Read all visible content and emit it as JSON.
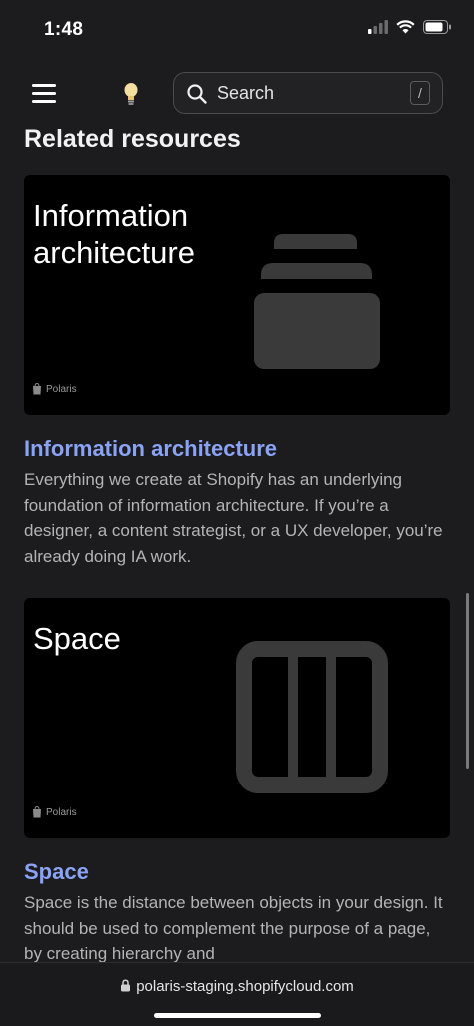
{
  "status_bar": {
    "time": "1:48"
  },
  "header": {
    "search": {
      "placeholder": "Search",
      "shortcut": "/"
    }
  },
  "section": {
    "title": "Related resources"
  },
  "cards": [
    {
      "thumb_title": "Information architecture",
      "brand": "Polaris",
      "title": "Information architecture",
      "description": "Everything we create at Shopify has an underlying foundation of information architecture. If you’re a designer, a content strategist, or a UX developer, you’re already doing IA work."
    },
    {
      "thumb_title": "Space",
      "brand": "Polaris",
      "title": "Space",
      "description": "Space is the distance between objects in your design. It should be used to complement the purpose of a page, by creating hierarchy and"
    }
  ],
  "browser": {
    "url": "polaris-staging.shopifycloud.com"
  },
  "colors": {
    "background": "#1c1c1f",
    "link": "#8aa3f5",
    "muted_text": "#b4b4b8",
    "thumb_shape": "#3a3a3a"
  }
}
